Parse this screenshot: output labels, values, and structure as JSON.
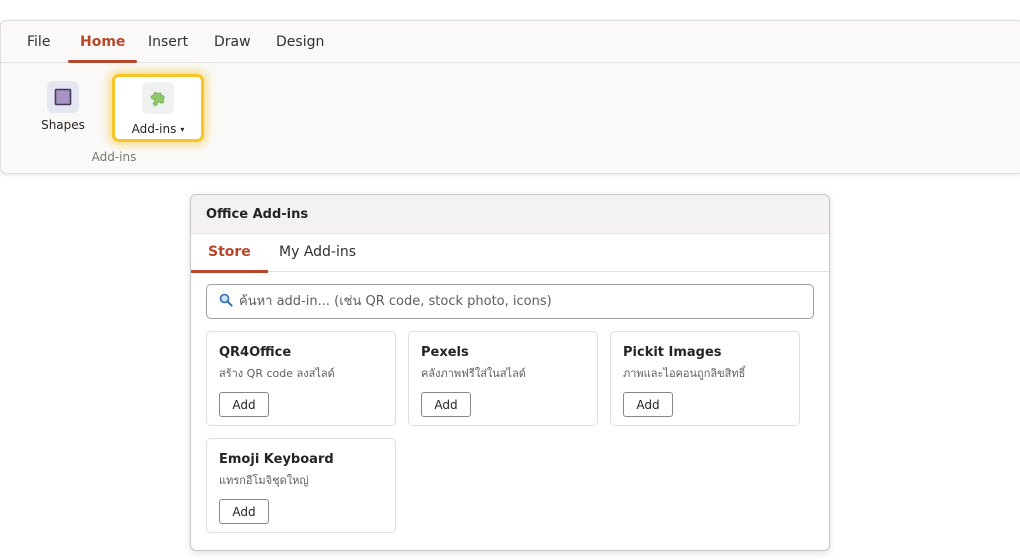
{
  "ribbon": {
    "tabs": [
      "File",
      "Home",
      "Insert",
      "Draw",
      "Design"
    ],
    "active_tab": "Home",
    "buttons": {
      "shapes": {
        "label": "Shapes",
        "icon": "shapes-icon"
      },
      "addins": {
        "label": "Add-ins",
        "icon": "puzzle-icon",
        "caret": "▾"
      }
    },
    "group_label": "Add-ins"
  },
  "panel": {
    "title": "Office Add-ins",
    "tabs": [
      "Store",
      "My Add-ins"
    ],
    "active_tab": "Store",
    "search": {
      "icon": "search-icon",
      "placeholder": "ค้นหา add-in... (เช่น QR code, stock photo, icons)",
      "value": ""
    },
    "addins": [
      {
        "name": "QR4Office",
        "description": "สร้าง QR code ลงสไลด์",
        "button": "Add"
      },
      {
        "name": "Pexels",
        "description": "คลังภาพฟรีใส่ในสไลด์",
        "button": "Add"
      },
      {
        "name": "Pickit Images",
        "description": "ภาพและไอคอนถูกลิขสิทธิ์",
        "button": "Add"
      },
      {
        "name": "Emoji Keyboard",
        "description": "แทรกอีโมจิชุดใหญ่",
        "button": "Add"
      }
    ]
  },
  "colors": {
    "accent": "#b7472a",
    "highlight": "#f7c526"
  }
}
